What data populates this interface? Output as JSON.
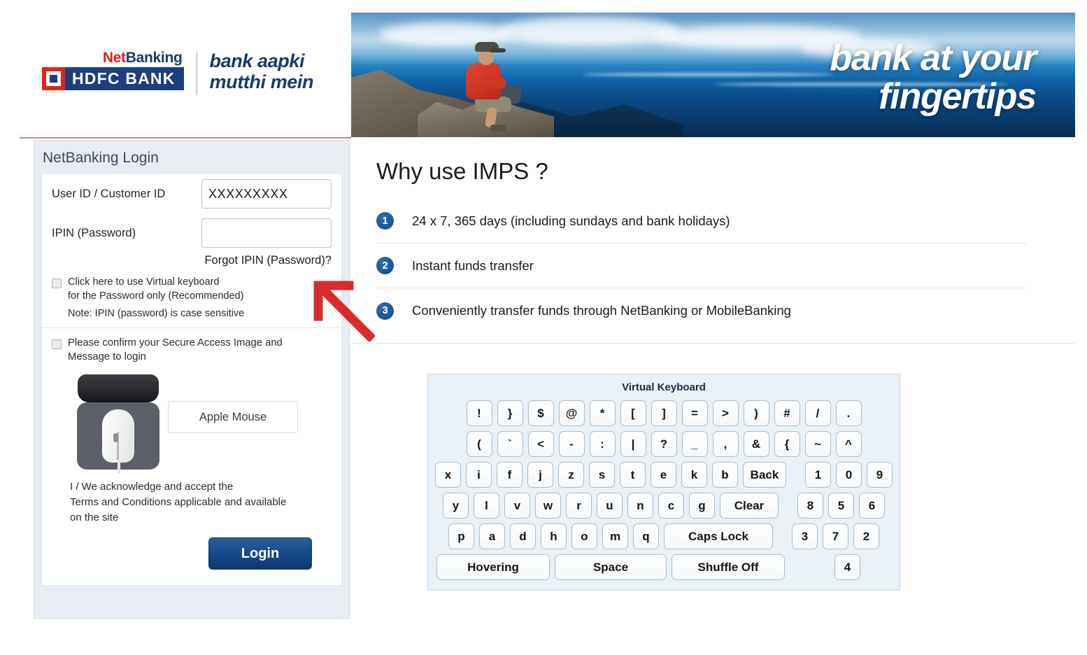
{
  "brand": {
    "netbanking_net": "Net",
    "netbanking_banking": "Banking",
    "bank_name": "HDFC BANK",
    "tagline_line1": "bank aapki",
    "tagline_line2": "mutthi mein"
  },
  "banner": {
    "headline_line1": "bank at your",
    "headline_line2": "fingertips"
  },
  "login": {
    "panel_title": "NetBanking Login",
    "user_id_label": "User ID / Customer ID",
    "user_id_value": "XXXXXXXXX",
    "user_id_placeholder": "",
    "ipin_label": "IPIN (Password)",
    "ipin_value": "",
    "ipin_placeholder": "",
    "forgot_link": "Forgot IPIN (Password)?",
    "virtual_keyboard_check_line1": "Click here to use Virtual keyboard",
    "virtual_keyboard_check_line2": "for the Password only (Recommended)",
    "note": "Note: IPIN (password) is case sensitive",
    "secure_access_line1": "Please confirm your Secure Access Image and",
    "secure_access_line2": "Message to login",
    "secure_access_message": "Apple Mouse",
    "terms_line1": "I / We acknowledge and accept the",
    "terms_line2": "Terms and Conditions applicable and available",
    "terms_line3": "on the site",
    "login_button": "Login"
  },
  "imps": {
    "title": "Why use IMPS ?",
    "items": [
      {
        "number": "1",
        "text": "24 x 7, 365 days (including sundays and bank holidays)"
      },
      {
        "number": "2",
        "text": "Instant funds transfer"
      },
      {
        "number": "3",
        "text": "Conveniently transfer funds through NetBanking or MobileBanking"
      }
    ]
  },
  "virtual_keyboard": {
    "title": "Virtual Keyboard",
    "row1": [
      "!",
      "}",
      "$",
      "@",
      "*",
      "[",
      "]",
      "=",
      ">",
      ")",
      "#",
      "/",
      "."
    ],
    "row2": [
      "(",
      "`",
      "<",
      "-",
      ":",
      "|",
      "?",
      "_",
      ",",
      "&",
      "{",
      "~",
      "^"
    ],
    "row3_letters": [
      "x",
      "i",
      "f",
      "j",
      "z",
      "s",
      "t",
      "e",
      "k",
      "b"
    ],
    "row3_action": "Back",
    "row3_numbers": [
      "1",
      "0",
      "9"
    ],
    "row4_letters": [
      "y",
      "l",
      "v",
      "w",
      "r",
      "u",
      "n",
      "c",
      "g"
    ],
    "row4_action": "Clear",
    "row4_numbers": [
      "8",
      "5",
      "6"
    ],
    "row5_letters": [
      "p",
      "a",
      "d",
      "h",
      "o",
      "m",
      "q"
    ],
    "row5_action": "Caps Lock",
    "row5_numbers": [
      "3",
      "7",
      "2"
    ],
    "row6_hovering": "Hovering",
    "row6_space": "Space",
    "row6_shuffle": "Shuffle Off",
    "row6_number": "4"
  },
  "colors": {
    "brand_red": "#e0241b",
    "brand_blue": "#1e3f7d",
    "arrow_red": "#d92b2b",
    "badge_blue": "#114a80",
    "login_button": "#0e3a70"
  }
}
